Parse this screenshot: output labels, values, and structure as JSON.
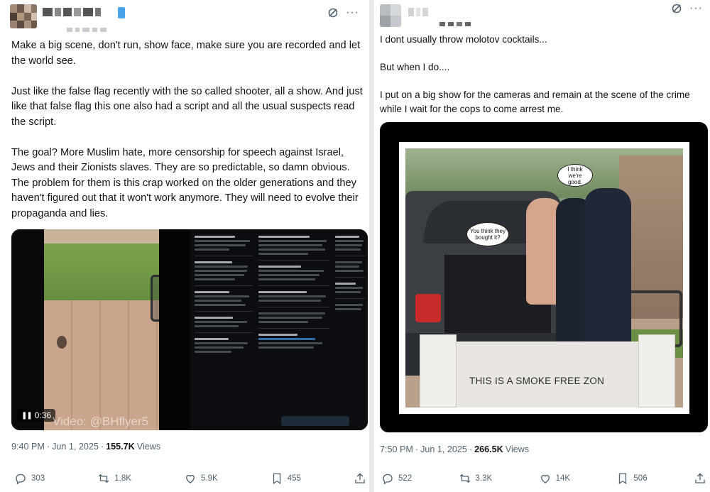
{
  "tweets": [
    {
      "paragraphs": [
        "Make a big scene, don't run, show face, make sure you are recorded and let the world see.",
        "Just like the false flag recently with the so called shooter, all a show. And just like that false flag this one also had a script and all the usual suspects read the script.",
        "The goal? More Muslim hate, more censorship for speech against Israel, Jews and their Zionists slaves. They are so predictable, so damn obvious. The problem for them is this crap worked on the older generations and they haven't figured out that it won't work anymore. They will need to evolve their propaganda and lies."
      ],
      "media": {
        "duration": "0:36",
        "watermark": "Video: @BHflyer5"
      },
      "time": "9:40 PM",
      "dot": "·",
      "date": "Jun 1, 2025",
      "views_count": "155.7K",
      "views_label": "Views",
      "stats": {
        "replies": "303",
        "reposts": "1.8K",
        "likes": "5.9K",
        "bookmarks": "455"
      }
    },
    {
      "paragraphs": [
        "I dont usually throw molotov cocktails...",
        "But when I do....",
        "I put on a big show for the cameras and remain at the scene of the crime while I wait for the cops to come arrest me."
      ],
      "media": {
        "bubble_1": "I think we're good.",
        "bubble_2": "You think they bought it?",
        "sign_text": "THIS IS A SMOKE FREE ZON"
      },
      "time": "7:50 PM",
      "dot": "·",
      "date": "Jun 1, 2025",
      "views_count": "266.5K",
      "views_label": "Views",
      "stats": {
        "replies": "522",
        "reposts": "3.3K",
        "likes": "14K",
        "bookmarks": "506"
      }
    }
  ],
  "icons": {
    "grok": "grok-icon",
    "more": "more-icon",
    "reply": "reply-icon",
    "repost": "repost-icon",
    "like": "like-icon",
    "bookmark": "bookmark-icon",
    "share": "share-icon"
  },
  "colors": {
    "text": "#0f1419",
    "muted": "#536471",
    "divider": "#e7e9ea"
  }
}
